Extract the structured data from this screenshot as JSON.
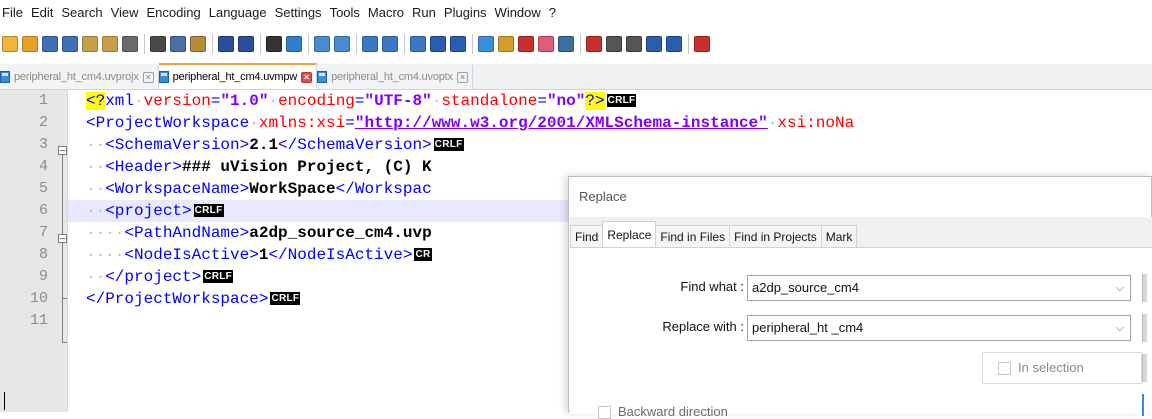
{
  "menu": [
    "File",
    "Edit",
    "Search",
    "View",
    "Encoding",
    "Language",
    "Settings",
    "Tools",
    "Macro",
    "Run",
    "Plugins",
    "Window",
    "?"
  ],
  "toolbar_icons": [
    {
      "name": "new-file-icon",
      "color": "#f2b53a"
    },
    {
      "name": "open-file-icon",
      "color": "#e9a02a"
    },
    {
      "name": "save-icon",
      "color": "#3f6fb5"
    },
    {
      "name": "save-all-icon",
      "color": "#3f6fb5"
    },
    {
      "name": "close-icon",
      "color": "#c9a04a"
    },
    {
      "name": "close-all-icon",
      "color": "#c9a04a"
    },
    {
      "name": "print-icon",
      "color": "#6b6b6b"
    },
    {
      "name": "sep"
    },
    {
      "name": "cut-icon",
      "color": "#4a4a4a"
    },
    {
      "name": "copy-icon",
      "color": "#4a6fa5"
    },
    {
      "name": "paste-icon",
      "color": "#b58b3a"
    },
    {
      "name": "sep"
    },
    {
      "name": "undo-icon",
      "color": "#2a4f9c"
    },
    {
      "name": "redo-icon",
      "color": "#2a4f9c"
    },
    {
      "name": "sep"
    },
    {
      "name": "find-icon",
      "color": "#333333"
    },
    {
      "name": "replace-icon",
      "color": "#2f7fc9"
    },
    {
      "name": "sep"
    },
    {
      "name": "zoom-in-icon",
      "color": "#4a8ad0"
    },
    {
      "name": "zoom-out-icon",
      "color": "#4a8ad0"
    },
    {
      "name": "sep"
    },
    {
      "name": "sync-v-icon",
      "color": "#3b78c4"
    },
    {
      "name": "sync-h-icon",
      "color": "#3b78c4"
    },
    {
      "name": "sep"
    },
    {
      "name": "word-wrap-icon",
      "color": "#3b78c4"
    },
    {
      "name": "show-all-chars-icon",
      "color": "#2a5db0"
    },
    {
      "name": "indent-guide-icon",
      "color": "#2a5db0"
    },
    {
      "name": "sep"
    },
    {
      "name": "udl-icon",
      "color": "#3a8fd6"
    },
    {
      "name": "doc-map-icon",
      "color": "#d79b2a"
    },
    {
      "name": "function-list-icon",
      "color": "#c9302c"
    },
    {
      "name": "folder-workspace-icon",
      "color": "#e05a7a"
    },
    {
      "name": "monitor-icon",
      "color": "#3a6fa0"
    },
    {
      "name": "sep"
    },
    {
      "name": "record-macro-icon",
      "color": "#c9302c"
    },
    {
      "name": "stop-macro-icon",
      "color": "#555555"
    },
    {
      "name": "play-macro-icon",
      "color": "#555555"
    },
    {
      "name": "run-macro-multiple-icon",
      "color": "#2a5db0"
    },
    {
      "name": "save-macro-icon",
      "color": "#2a5db0"
    },
    {
      "name": "sep"
    },
    {
      "name": "spell-check-icon",
      "color": "#c9302c"
    }
  ],
  "tabs": [
    {
      "label": "peripheral_ht_cm4.uvprojx",
      "active": false
    },
    {
      "label": "peripheral_ht_cm4.uvmpw",
      "active": true
    },
    {
      "label": "peripheral_ht_cm4.uvoptx",
      "active": false
    }
  ],
  "editor": {
    "line_numbers": [
      "1",
      "2",
      "3",
      "4",
      "5",
      "6",
      "7",
      "8",
      "9",
      "10",
      "11"
    ],
    "crlf_label": "CRLF",
    "l1": {
      "open": "<?",
      "xml": "xml",
      "a1": "version",
      "v1": "\"1.0\"",
      "a2": "encoding",
      "v2": "\"UTF-8\"",
      "a3": "standalone",
      "v3": "\"no\"",
      "close": "?>"
    },
    "l2": {
      "tag": "<ProjectWorkspace",
      "a1": "xmlns:xsi",
      "url": "\"http://www.w3.org/2001/XMLSchema-instance\"",
      "a2": "xsi:noNa"
    },
    "l3": {
      "open": "<SchemaVersion>",
      "text": "2.1",
      "close": "</SchemaVersion>"
    },
    "l4": {
      "open": "<Header>",
      "text": "### uVision Project, (C) K"
    },
    "l5": {
      "open": "<WorkspaceName>",
      "text": "WorkSpace",
      "close": "</Workspac"
    },
    "l6": {
      "open": "<project>"
    },
    "l7": {
      "open": "<PathAndName>",
      "text": "a2dp_source_cm4.uvp"
    },
    "l8": {
      "open": "<NodeIsActive>",
      "text": "1",
      "close": "</NodeIsActive>",
      "crlf_part": "CR"
    },
    "l9": {
      "close": "</project>"
    },
    "l10": {
      "close": "</ProjectWorkspace>"
    }
  },
  "dialog": {
    "title": "Replace",
    "tabs": [
      "Find",
      "Replace",
      "Find in Files",
      "Find in Projects",
      "Mark"
    ],
    "find_label": "Find what :",
    "find_value": "a2dp_source_cm4",
    "replace_label": "Replace with :",
    "replace_value": "peripheral_ht _cm4",
    "in_selection": "In selection",
    "backward": "Backward direction"
  }
}
